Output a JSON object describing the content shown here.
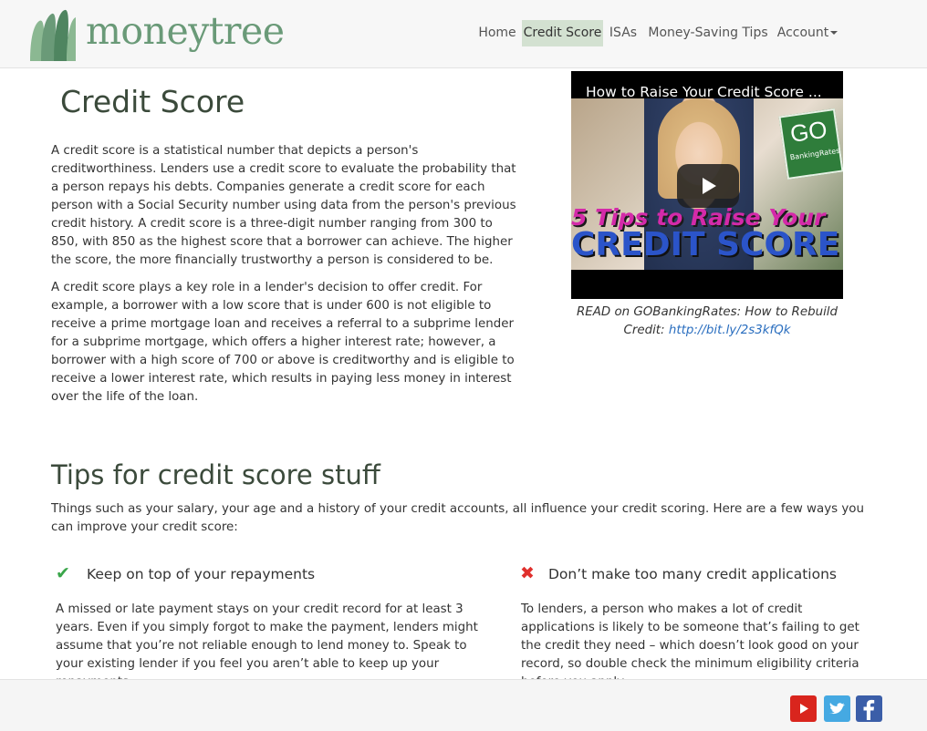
{
  "brand": {
    "name": "moneytree"
  },
  "nav": {
    "items": [
      {
        "label": "Home"
      },
      {
        "label": "Credit Score"
      },
      {
        "label": "ISAs"
      },
      {
        "label": "Money-Saving Tips"
      },
      {
        "label": "Account"
      }
    ]
  },
  "main": {
    "title": "Credit Score",
    "paragraphs": [
      "A credit score is a statistical number that depicts a person's creditworthiness. Lenders use a credit score to evaluate the probability that a person repays his debts. Companies generate a credit score for each person with a Social Security number using data from the person's previous credit history. A credit score is a three-digit number ranging from 300 to 850, with 850 as the highest score that a borrower can achieve. The higher the score, the more financially trustworthy a person is considered to be.",
      "A credit score plays a key role in a lender's decision to offer credit. For example, a borrower with a low score that is under 600 is not eligible to receive a prime mortgage loan and receives a referral to a subprime lender for a subprime mortgage, which offers a higher interest rate; however, a borrower with a high score of 700 or above is creditworthy and is eligible to receive a lower interest rate, which results in paying less money in interest over the life of the loan."
    ]
  },
  "video": {
    "title": "How to Raise Your Credit Score ...",
    "logo_text": "GO",
    "logo_sub": "BankingRates",
    "overlay_line1": "5 Tips to Raise Your",
    "overlay_line2": "CREDIT SCORE",
    "caption_text": "READ on GOBankingRates: How to Rebuild Credit: ",
    "caption_link": "http://bit.ly/2s3kfQk"
  },
  "tips": {
    "title": "Tips for credit score stuff",
    "intro": "Things such as your salary, your age and a history of your credit accounts, all influence your credit scoring. Here are a few ways you can improve your credit score:",
    "items": [
      {
        "icon": "checkmark-icon",
        "heading": "Keep on top of your repayments",
        "body": "A missed or late payment stays on your credit record for at least 3 years. Even if you simply forgot to make the payment, lenders might assume that you’re not reliable enough to lend money to. Speak to your existing lender if you feel you aren’t able to keep up your repayments."
      },
      {
        "icon": "cross-icon",
        "heading": "Don’t make too many credit applications",
        "body": "To lenders, a person who makes a lot of credit applications is likely to be someone that’s failing to get the credit they need – which doesn’t look good on your record, so double check the minimum eligibility criteria before you apply."
      }
    ]
  },
  "colors": {
    "brand_green": "#6a9a78",
    "nav_active_bg": "#d3e1d1",
    "check_green": "#3aa64a",
    "cross_red": "#e0302d",
    "link_blue": "#2a6ebf"
  },
  "footer": {
    "social": [
      "youtube-icon",
      "twitter-icon",
      "facebook-icon"
    ]
  }
}
